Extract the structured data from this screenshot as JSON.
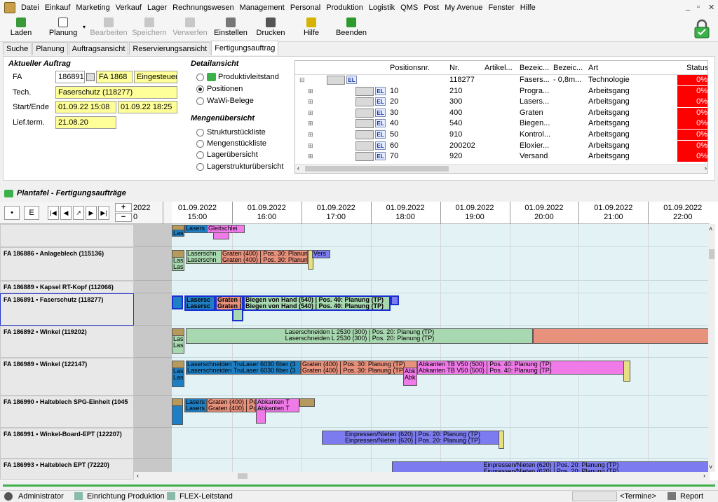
{
  "menu": [
    "Datei",
    "Einkauf",
    "Marketing",
    "Verkauf",
    "Lager",
    "Rechnungswesen",
    "Management",
    "Personal",
    "Produktion",
    "Logistik",
    "QMS",
    "Post",
    "My Avenue",
    "Fenster",
    "Hilfe"
  ],
  "toolbar": {
    "laden": "Laden",
    "planung": "Planung",
    "bearbeiten": "Bearbeiten",
    "speichern": "Speichern",
    "verwerfen": "Verwerfen",
    "einstellen": "Einstellen",
    "drucken": "Drucken",
    "hilfe": "Hilfe",
    "beenden": "Beenden"
  },
  "tabs": [
    "Suche",
    "Planung",
    "Auftragsansicht",
    "Reservierungsansicht",
    "Fertigungsauftrag"
  ],
  "auftrag": {
    "title": "Aktueller Auftrag",
    "fa_label": "FA",
    "fa_num": "186891",
    "fa_code": "FA 1868",
    "fa_status": "Eingesteuert",
    "tech_label": "Tech.",
    "tech": "Faserschutz (118277)",
    "startende_label": "Start/Ende",
    "start": "01.09.22 15:08",
    "ende": "01.09.22 18:25",
    "lief_label": "Lief.term.",
    "lief": "21.08.20"
  },
  "detail": {
    "title": "Detailansicht",
    "options": [
      "Produktivleitstand",
      "Positionen",
      "WaWi-Belege"
    ],
    "menge_title": "Mengenübersicht",
    "menge_options": [
      "Strukturstückliste",
      "Mengenstückliste",
      "Lagerübersicht",
      "Lagerstrukturübersicht"
    ]
  },
  "postable": {
    "headers": [
      "Positionsnr.",
      "Nr.",
      "Artikel...",
      "Bezeic...",
      "Bezeic...",
      "Art",
      "Status"
    ],
    "rows": [
      {
        "pos": "",
        "nr": "118277",
        "art_nr": "",
        "bez1": "Fasers...",
        "bez2": "- 0,8m...",
        "art": "Technologie",
        "status": "0%"
      },
      {
        "pos": "10",
        "nr": "210",
        "art_nr": "",
        "bez1": "Progra...",
        "bez2": "",
        "art": "Arbeitsgang",
        "status": "0%"
      },
      {
        "pos": "20",
        "nr": "300",
        "art_nr": "",
        "bez1": "Lasers...",
        "bez2": "",
        "art": "Arbeitsgang",
        "status": "0%"
      },
      {
        "pos": "30",
        "nr": "400",
        "art_nr": "",
        "bez1": "Graten",
        "bez2": "",
        "art": "Arbeitsgang",
        "status": "0%"
      },
      {
        "pos": "40",
        "nr": "540",
        "art_nr": "",
        "bez1": "Biegen...",
        "bez2": "",
        "art": "Arbeitsgang",
        "status": "0%"
      },
      {
        "pos": "50",
        "nr": "910",
        "art_nr": "",
        "bez1": "Kontrol...",
        "bez2": "",
        "art": "Arbeitsgang",
        "status": "0%"
      },
      {
        "pos": "60",
        "nr": "200202",
        "art_nr": "",
        "bez1": "Eloxier...",
        "bez2": "",
        "art": "Arbeitsgang",
        "status": "0%"
      },
      {
        "pos": "70",
        "nr": "920",
        "art_nr": "",
        "bez1": "Versand",
        "bez2": "",
        "art": "Arbeitsgang",
        "status": "0%"
      }
    ]
  },
  "plantafel": {
    "title": "Plantafel - Fertigungsaufträge",
    "nav_buttons": [
      "•",
      "E",
      "|◀",
      "◀",
      "↗",
      "▶",
      "▶|"
    ],
    "zoom_in": "+",
    "zoom_out": "−",
    "prev_date": "2022",
    "prev_hour": "0",
    "times": [
      {
        "date": "01.09.2022",
        "hour": "15:00"
      },
      {
        "date": "01.09.2022",
        "hour": "16:00"
      },
      {
        "date": "01.09.2022",
        "hour": "17:00"
      },
      {
        "date": "01.09.2022",
        "hour": "18:00"
      },
      {
        "date": "01.09.2022",
        "hour": "19:00"
      },
      {
        "date": "01.09.2022",
        "hour": "20:00"
      },
      {
        "date": "01.09.2022",
        "hour": "21:00"
      },
      {
        "date": "01.09.2022",
        "hour": "22:00"
      }
    ],
    "rows": [
      {
        "label": ""
      },
      {
        "label": "FA 186886 • Anlageblech (115136)"
      },
      {
        "label": "FA 186889 • Kapsel RT-Kopf (112066)"
      },
      {
        "label": "FA 186891 • Faserschutz (118277)"
      },
      {
        "label": "FA 186892 • Winkel (119202)"
      },
      {
        "label": "FA 186989 • Winkel (122147)"
      },
      {
        "label": "FA 186990 • Halteblech SPG-Einheit (1045"
      },
      {
        "label": "FA 186991 • Winkel-Board-EPT (122207)"
      },
      {
        "label": "FA 186993 • Halteblech EPT (72220)"
      }
    ],
    "bar_texts": {
      "r0a": "Lasers",
      "r0b": "Gleitschlei",
      "r0c": "Las",
      "r1a": "Laserschn",
      "r1b": "Graten (400) | Pos. 30: Planun",
      "r1c": "Vers",
      "r1d": "Las",
      "r3a": "Lasersc",
      "r3b": "Graten (",
      "r3c": "Biegen von Hand (540) | Pos. 40: Planung (TP)",
      "r4a": "Laserschneiden L 2530 (300) | Pos. 20: Planung (TP)",
      "r4b": "Las",
      "r5a": "Laserschneiden TruLaser 6030 fiber (3",
      "r5b": "Graten (400) | Pos. 30: Planung (TP)",
      "r5c": "Abkanten TB V50 (500) | Pos. 40: Planung (TP)",
      "r5d": "Abk",
      "r5e": "Las",
      "r6a": "Lasers",
      "r6b": "Graten (400) | Pos.",
      "r6c": "Abkanten T",
      "r7a": "Einpressen/Nieten (620) | Pos. 20: Planung (TP)",
      "r8a": "Einpressen/Nieten (620) | Pos. 20: Planung (TP)"
    }
  },
  "statusbar": {
    "user": "Administrator",
    "module1": "Einrichtung Produktion",
    "module2": "FLEX-Leitstand",
    "termine": "<Termine>",
    "report": "Report"
  },
  "colors": {
    "status_red": "#ff0000",
    "field_yellow": "#ffff9a",
    "bar_blue": "#1f7fc4",
    "bar_green": "#a8d8b0",
    "bar_salmon": "#e8917c",
    "bar_pink": "#f07ae8",
    "bar_violet": "#7c7cf0",
    "bar_olive": "#b59a5c"
  }
}
